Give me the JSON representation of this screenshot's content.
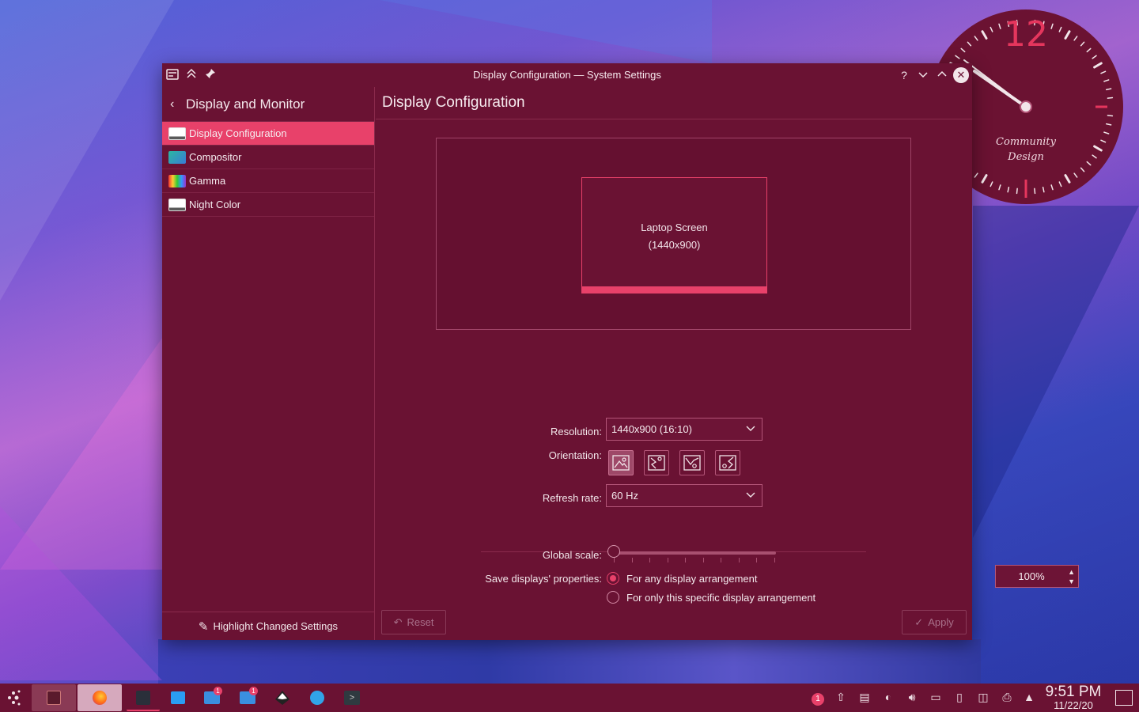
{
  "window": {
    "title": "Display Configuration — System Settings"
  },
  "sidebar": {
    "back_title": "Display and Monitor",
    "items": [
      {
        "label": "Display Configuration",
        "icon": "display-icon",
        "active": true
      },
      {
        "label": "Compositor",
        "icon": "compositor-icon",
        "active": false
      },
      {
        "label": "Gamma",
        "icon": "gamma-icon",
        "active": false
      },
      {
        "label": "Night Color",
        "icon": "night-color-icon",
        "active": false
      }
    ],
    "footer_label": "Highlight Changed Settings"
  },
  "main": {
    "page_title": "Display Configuration",
    "screen_name": "Laptop Screen",
    "screen_resolution": "(1440x900)",
    "resolution_label": "Resolution:",
    "resolution_value": "1440x900 (16:10)",
    "orientation_label": "Orientation:",
    "orientation_selected_index": 0,
    "refresh_label": "Refresh rate:",
    "refresh_value": "60 Hz",
    "scale_label": "Global scale:",
    "scale_value": "100%",
    "scale_level": 0,
    "save_label": "Save displays' properties:",
    "save_options": [
      {
        "label": "For any display arrangement",
        "checked": true
      },
      {
        "label": "For only this specific display arrangement",
        "checked": false
      }
    ],
    "reset_label": "Reset",
    "apply_label": "Apply"
  },
  "clock": {
    "hour_numeral": "12",
    "brand_line1": "Community",
    "brand_line2": "Design"
  },
  "taskbar": {
    "time": "9:51 PM",
    "date": "11/22/20",
    "notification_count": "1",
    "badge_count": "1"
  },
  "colors": {
    "accent": "#e8416a",
    "window_bg": "#6a1233"
  }
}
